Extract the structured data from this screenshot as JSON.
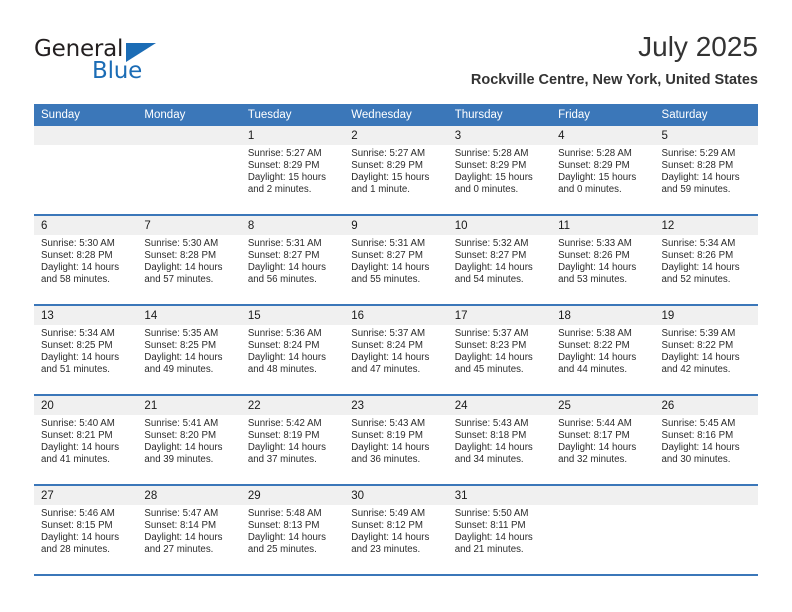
{
  "brand": {
    "name_top": "General",
    "name_bottom": "Blue",
    "accent_color": "#1b6cb5"
  },
  "header": {
    "title": "July 2025",
    "subtitle": "Rockville Centre, New York, United States",
    "header_bg_color": "#3b77b9",
    "day_band_color": "#f0f0f0"
  },
  "weekdays": [
    "Sunday",
    "Monday",
    "Tuesday",
    "Wednesday",
    "Thursday",
    "Friday",
    "Saturday"
  ],
  "weeks": [
    [
      {
        "day": "",
        "sunrise": "",
        "sunset": "",
        "daylight_line1": "",
        "daylight_line2": ""
      },
      {
        "day": "",
        "sunrise": "",
        "sunset": "",
        "daylight_line1": "",
        "daylight_line2": ""
      },
      {
        "day": "1",
        "sunrise": "Sunrise: 5:27 AM",
        "sunset": "Sunset: 8:29 PM",
        "daylight_line1": "Daylight: 15 hours",
        "daylight_line2": "and 2 minutes."
      },
      {
        "day": "2",
        "sunrise": "Sunrise: 5:27 AM",
        "sunset": "Sunset: 8:29 PM",
        "daylight_line1": "Daylight: 15 hours",
        "daylight_line2": "and 1 minute."
      },
      {
        "day": "3",
        "sunrise": "Sunrise: 5:28 AM",
        "sunset": "Sunset: 8:29 PM",
        "daylight_line1": "Daylight: 15 hours",
        "daylight_line2": "and 0 minutes."
      },
      {
        "day": "4",
        "sunrise": "Sunrise: 5:28 AM",
        "sunset": "Sunset: 8:29 PM",
        "daylight_line1": "Daylight: 15 hours",
        "daylight_line2": "and 0 minutes."
      },
      {
        "day": "5",
        "sunrise": "Sunrise: 5:29 AM",
        "sunset": "Sunset: 8:28 PM",
        "daylight_line1": "Daylight: 14 hours",
        "daylight_line2": "and 59 minutes."
      }
    ],
    [
      {
        "day": "6",
        "sunrise": "Sunrise: 5:30 AM",
        "sunset": "Sunset: 8:28 PM",
        "daylight_line1": "Daylight: 14 hours",
        "daylight_line2": "and 58 minutes."
      },
      {
        "day": "7",
        "sunrise": "Sunrise: 5:30 AM",
        "sunset": "Sunset: 8:28 PM",
        "daylight_line1": "Daylight: 14 hours",
        "daylight_line2": "and 57 minutes."
      },
      {
        "day": "8",
        "sunrise": "Sunrise: 5:31 AM",
        "sunset": "Sunset: 8:27 PM",
        "daylight_line1": "Daylight: 14 hours",
        "daylight_line2": "and 56 minutes."
      },
      {
        "day": "9",
        "sunrise": "Sunrise: 5:31 AM",
        "sunset": "Sunset: 8:27 PM",
        "daylight_line1": "Daylight: 14 hours",
        "daylight_line2": "and 55 minutes."
      },
      {
        "day": "10",
        "sunrise": "Sunrise: 5:32 AM",
        "sunset": "Sunset: 8:27 PM",
        "daylight_line1": "Daylight: 14 hours",
        "daylight_line2": "and 54 minutes."
      },
      {
        "day": "11",
        "sunrise": "Sunrise: 5:33 AM",
        "sunset": "Sunset: 8:26 PM",
        "daylight_line1": "Daylight: 14 hours",
        "daylight_line2": "and 53 minutes."
      },
      {
        "day": "12",
        "sunrise": "Sunrise: 5:34 AM",
        "sunset": "Sunset: 8:26 PM",
        "daylight_line1": "Daylight: 14 hours",
        "daylight_line2": "and 52 minutes."
      }
    ],
    [
      {
        "day": "13",
        "sunrise": "Sunrise: 5:34 AM",
        "sunset": "Sunset: 8:25 PM",
        "daylight_line1": "Daylight: 14 hours",
        "daylight_line2": "and 51 minutes."
      },
      {
        "day": "14",
        "sunrise": "Sunrise: 5:35 AM",
        "sunset": "Sunset: 8:25 PM",
        "daylight_line1": "Daylight: 14 hours",
        "daylight_line2": "and 49 minutes."
      },
      {
        "day": "15",
        "sunrise": "Sunrise: 5:36 AM",
        "sunset": "Sunset: 8:24 PM",
        "daylight_line1": "Daylight: 14 hours",
        "daylight_line2": "and 48 minutes."
      },
      {
        "day": "16",
        "sunrise": "Sunrise: 5:37 AM",
        "sunset": "Sunset: 8:24 PM",
        "daylight_line1": "Daylight: 14 hours",
        "daylight_line2": "and 47 minutes."
      },
      {
        "day": "17",
        "sunrise": "Sunrise: 5:37 AM",
        "sunset": "Sunset: 8:23 PM",
        "daylight_line1": "Daylight: 14 hours",
        "daylight_line2": "and 45 minutes."
      },
      {
        "day": "18",
        "sunrise": "Sunrise: 5:38 AM",
        "sunset": "Sunset: 8:22 PM",
        "daylight_line1": "Daylight: 14 hours",
        "daylight_line2": "and 44 minutes."
      },
      {
        "day": "19",
        "sunrise": "Sunrise: 5:39 AM",
        "sunset": "Sunset: 8:22 PM",
        "daylight_line1": "Daylight: 14 hours",
        "daylight_line2": "and 42 minutes."
      }
    ],
    [
      {
        "day": "20",
        "sunrise": "Sunrise: 5:40 AM",
        "sunset": "Sunset: 8:21 PM",
        "daylight_line1": "Daylight: 14 hours",
        "daylight_line2": "and 41 minutes."
      },
      {
        "day": "21",
        "sunrise": "Sunrise: 5:41 AM",
        "sunset": "Sunset: 8:20 PM",
        "daylight_line1": "Daylight: 14 hours",
        "daylight_line2": "and 39 minutes."
      },
      {
        "day": "22",
        "sunrise": "Sunrise: 5:42 AM",
        "sunset": "Sunset: 8:19 PM",
        "daylight_line1": "Daylight: 14 hours",
        "daylight_line2": "and 37 minutes."
      },
      {
        "day": "23",
        "sunrise": "Sunrise: 5:43 AM",
        "sunset": "Sunset: 8:19 PM",
        "daylight_line1": "Daylight: 14 hours",
        "daylight_line2": "and 36 minutes."
      },
      {
        "day": "24",
        "sunrise": "Sunrise: 5:43 AM",
        "sunset": "Sunset: 8:18 PM",
        "daylight_line1": "Daylight: 14 hours",
        "daylight_line2": "and 34 minutes."
      },
      {
        "day": "25",
        "sunrise": "Sunrise: 5:44 AM",
        "sunset": "Sunset: 8:17 PM",
        "daylight_line1": "Daylight: 14 hours",
        "daylight_line2": "and 32 minutes."
      },
      {
        "day": "26",
        "sunrise": "Sunrise: 5:45 AM",
        "sunset": "Sunset: 8:16 PM",
        "daylight_line1": "Daylight: 14 hours",
        "daylight_line2": "and 30 minutes."
      }
    ],
    [
      {
        "day": "27",
        "sunrise": "Sunrise: 5:46 AM",
        "sunset": "Sunset: 8:15 PM",
        "daylight_line1": "Daylight: 14 hours",
        "daylight_line2": "and 28 minutes."
      },
      {
        "day": "28",
        "sunrise": "Sunrise: 5:47 AM",
        "sunset": "Sunset: 8:14 PM",
        "daylight_line1": "Daylight: 14 hours",
        "daylight_line2": "and 27 minutes."
      },
      {
        "day": "29",
        "sunrise": "Sunrise: 5:48 AM",
        "sunset": "Sunset: 8:13 PM",
        "daylight_line1": "Daylight: 14 hours",
        "daylight_line2": "and 25 minutes."
      },
      {
        "day": "30",
        "sunrise": "Sunrise: 5:49 AM",
        "sunset": "Sunset: 8:12 PM",
        "daylight_line1": "Daylight: 14 hours",
        "daylight_line2": "and 23 minutes."
      },
      {
        "day": "31",
        "sunrise": "Sunrise: 5:50 AM",
        "sunset": "Sunset: 8:11 PM",
        "daylight_line1": "Daylight: 14 hours",
        "daylight_line2": "and 21 minutes."
      },
      {
        "day": "",
        "sunrise": "",
        "sunset": "",
        "daylight_line1": "",
        "daylight_line2": ""
      },
      {
        "day": "",
        "sunrise": "",
        "sunset": "",
        "daylight_line1": "",
        "daylight_line2": ""
      }
    ]
  ]
}
